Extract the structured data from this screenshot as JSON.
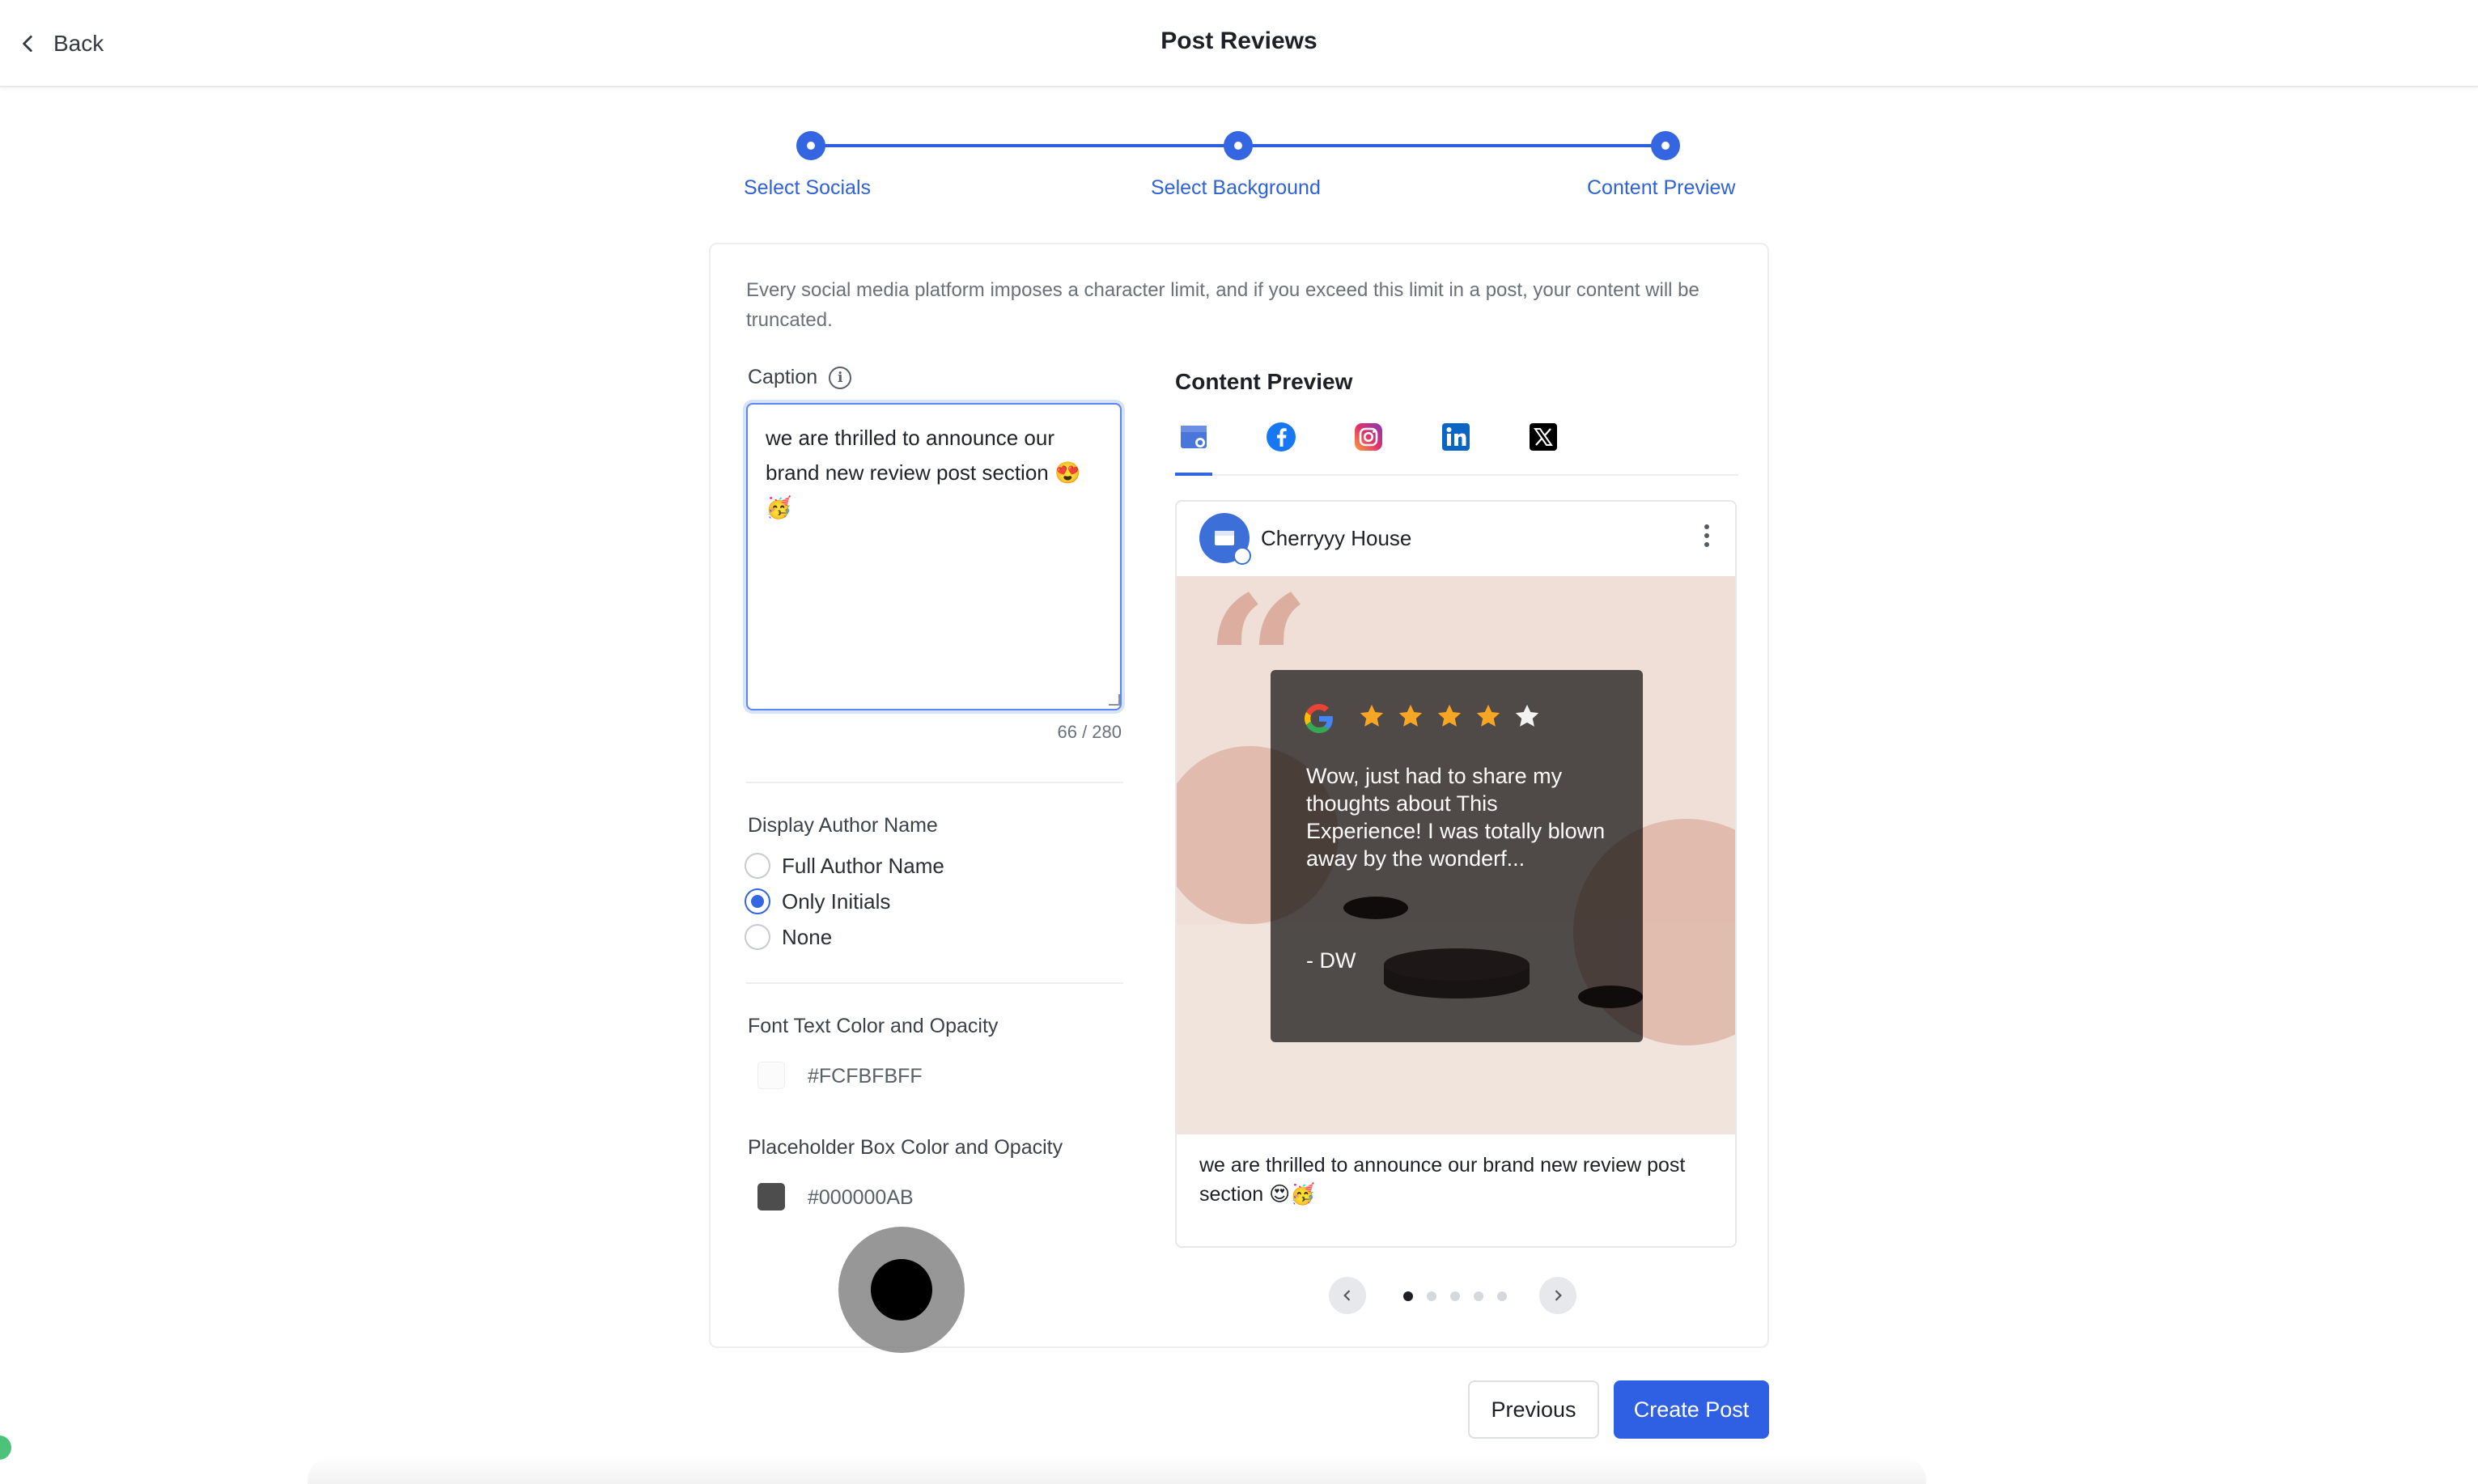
{
  "header": {
    "back_label": "Back",
    "title": "Post Reviews"
  },
  "stepper": {
    "steps": [
      {
        "label": "Select Socials"
      },
      {
        "label": "Select Background"
      },
      {
        "label": "Content Preview"
      }
    ],
    "accent_color": "#3366E0"
  },
  "notice": "Every social media platform imposes a character limit, and if you exceed this limit in a post, your content will be truncated.",
  "caption": {
    "label": "Caption",
    "value": "we are thrilled to announce our brand new review post section 😍🥳",
    "count": "66 / 280"
  },
  "author_display": {
    "label": "Display Author Name",
    "options": [
      {
        "label": "Full Author Name",
        "checked": false
      },
      {
        "label": "Only Initials",
        "checked": true
      },
      {
        "label": "None",
        "checked": false
      }
    ]
  },
  "font_color": {
    "label": "Font Text Color and Opacity",
    "value": "#FCFBFBFF"
  },
  "box_color": {
    "label": "Placeholder Box Color and Opacity",
    "value": "#000000AB"
  },
  "preview": {
    "title": "Content Preview",
    "tabs": [
      {
        "icon": "google-business-icon",
        "active": true
      },
      {
        "icon": "facebook-icon",
        "active": false
      },
      {
        "icon": "instagram-icon",
        "active": false
      },
      {
        "icon": "linkedin-icon",
        "active": false
      },
      {
        "icon": "x-icon",
        "active": false
      }
    ],
    "account_name": "Cherryyy House",
    "review": {
      "rating": 5,
      "text": "Wow, just had to share my thoughts about This Experience! I was totally blown away by the wonderf...",
      "author": "- DW"
    },
    "caption": "we are thrilled to announce our brand new review post section 😍🥳",
    "carousel": {
      "pages": 5,
      "current": 1
    }
  },
  "footer": {
    "previous_label": "Previous",
    "create_label": "Create Post"
  }
}
